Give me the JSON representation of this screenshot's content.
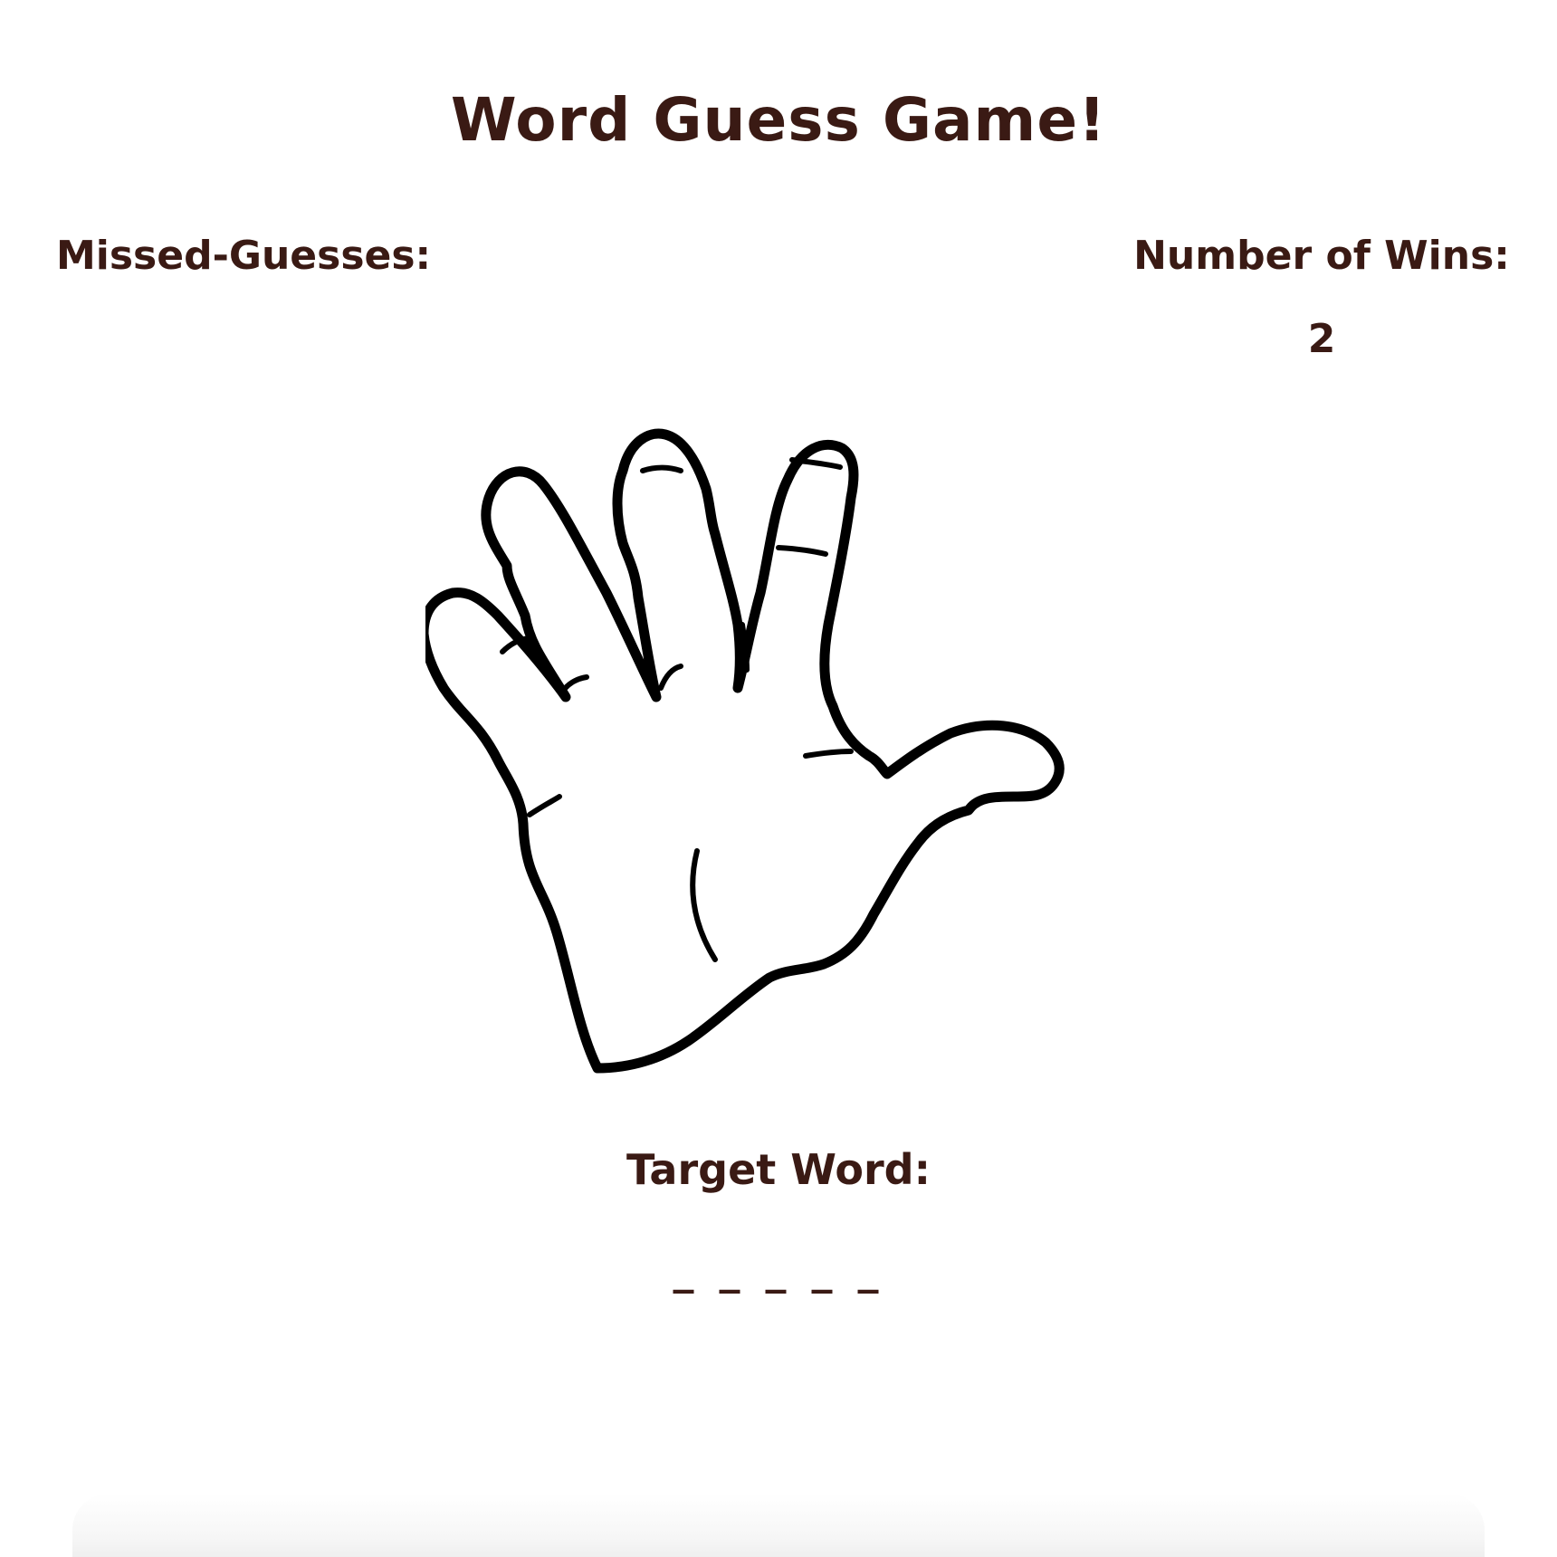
{
  "game": {
    "title": "Word Guess Game!",
    "missed_label": "Missed-Guesses:",
    "missed_value": "",
    "wins_label": "Number of Wins:",
    "wins_value": "2",
    "target_label": "Target Word:",
    "target_word": "_ _ _ _ _"
  },
  "image": {
    "icon": "hand-icon"
  },
  "colors": {
    "text": "#3a1a14",
    "background": "#ffffff",
    "outline": "#000000"
  }
}
